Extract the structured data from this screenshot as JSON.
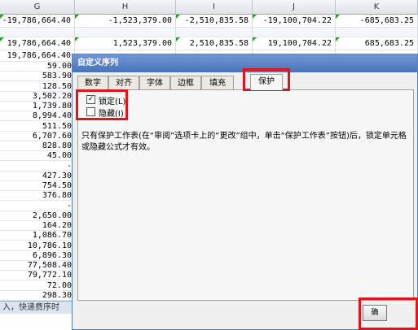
{
  "columns": [
    {
      "label": "G"
    },
    {
      "label": "H"
    },
    {
      "label": "I"
    },
    {
      "label": "J"
    },
    {
      "label": "K"
    }
  ],
  "top_rows": [
    [
      "-19,786,664.40",
      "-1,523,379.00",
      "-2,510,835.58",
      "-19,100,704.22",
      "-685,683.25"
    ],
    [
      "",
      "",
      "",
      "",
      ""
    ],
    [
      "19,786,664.40",
      "1,523,379.00",
      "2,510,835.58",
      "19,100,704.22",
      "685,683.25"
    ],
    [
      "19,786,664.40",
      "",
      "",
      "",
      ""
    ]
  ],
  "column_g_values": [
    "59.00",
    "583.90",
    "128.50",
    "3,502.20",
    "1,739.80",
    "8,994.40",
    "511.50",
    "6,707.60",
    "828.80",
    "45.00",
    "-",
    "427.30",
    "754.50",
    "376.80",
    "-",
    "2,650.00",
    "164.20",
    "1,086.70",
    "10,786.10",
    "6,896.30",
    "77,508.40",
    "79,772.10",
    "72.00",
    "298.30"
  ],
  "statusbar_text": "入，快递费序时",
  "dialog": {
    "title": "自定义序列",
    "tabs": [
      "数字",
      "对齐",
      "字体",
      "边框",
      "填充",
      "保护"
    ],
    "active_tab": "保护",
    "locked_label": "锁定(L)",
    "locked_checked": "✓",
    "hidden_label": "隐藏(I)",
    "description": "只有保护工作表(在“审阅”选项卡上的“更改”组中，单击“保护工作表”按钮)后，锁定单元格或隐藏公式才有效。",
    "ok_label": "确"
  }
}
